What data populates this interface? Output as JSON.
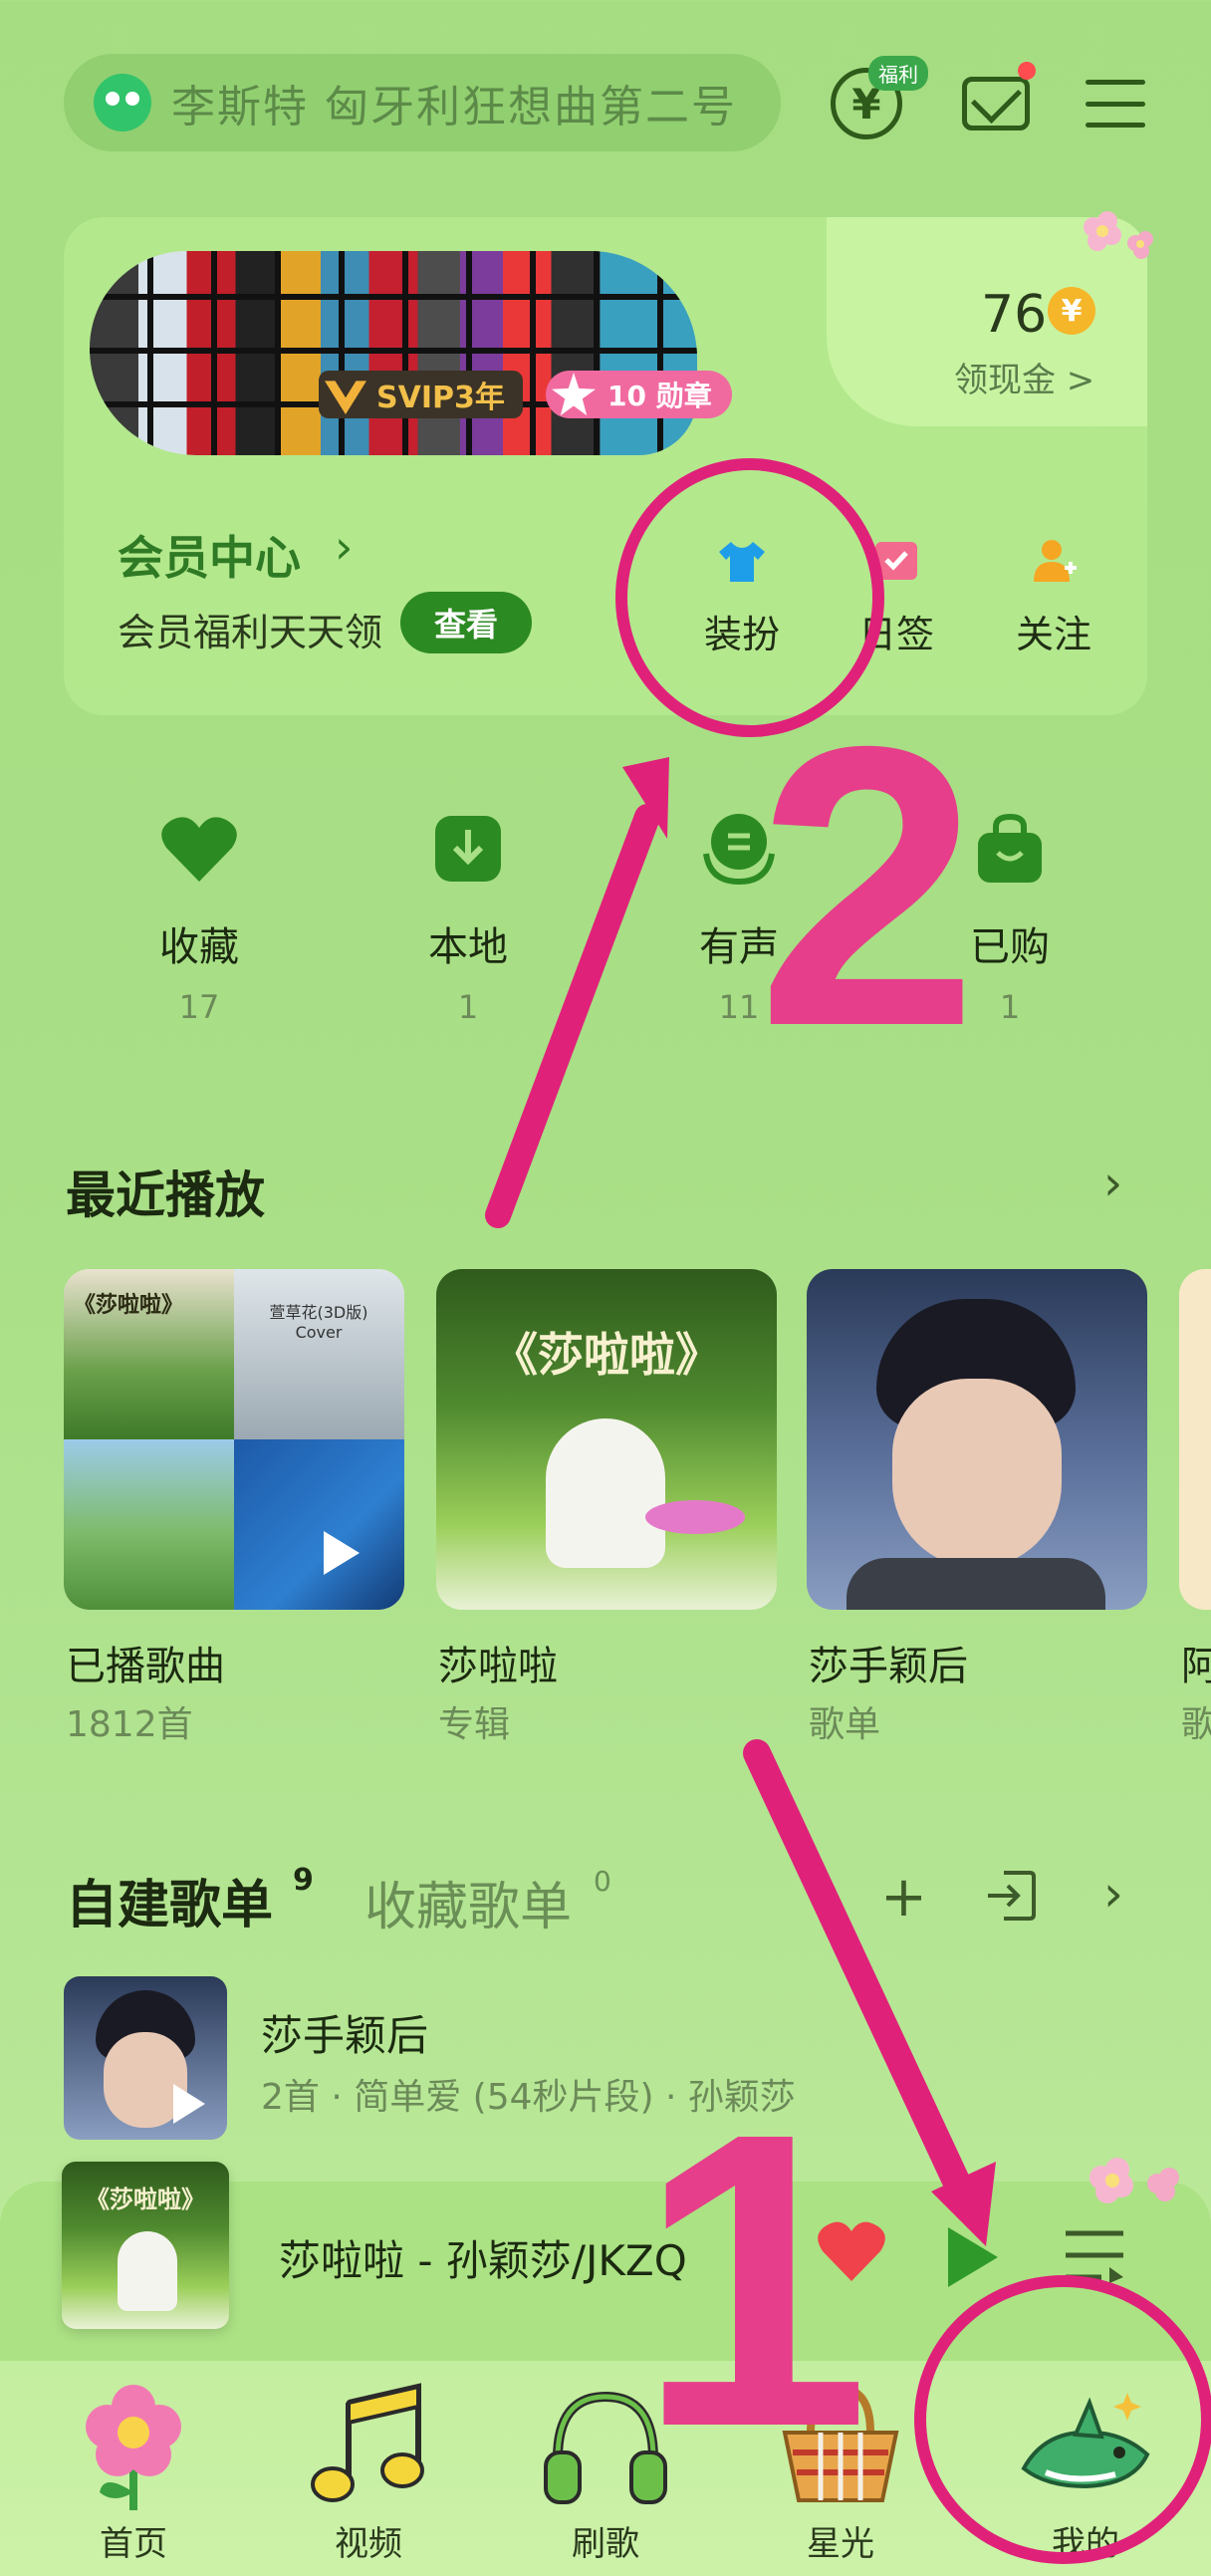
{
  "search": {
    "placeholder": "李斯特 匈牙利狂想曲第二号"
  },
  "header": {
    "welfare_badge": "福利",
    "yen_symbol": "¥"
  },
  "vip": {
    "svip_badge": "SVIP3年",
    "medal_badge": "10 勋章",
    "coins": "76",
    "coin_symbol": "¥",
    "coin_link": "领现金 >",
    "center_label": "会员中心",
    "benefit_text": "会员福利天天领",
    "view_button": "查看",
    "quick_actions": [
      {
        "label": "装扮",
        "icon": "shirt-icon"
      },
      {
        "label": "日签",
        "icon": "calendar-check-icon"
      },
      {
        "label": "关注",
        "icon": "user-add-icon"
      }
    ]
  },
  "categories": [
    {
      "label": "收藏",
      "count": "17",
      "icon": "heart-icon"
    },
    {
      "label": "本地",
      "count": "1",
      "icon": "download-icon"
    },
    {
      "label": "有声",
      "count": "11",
      "icon": "audiobook-icon"
    },
    {
      "label": "已购",
      "count": "1",
      "icon": "bag-icon"
    }
  ],
  "recent": {
    "title": "最近播放",
    "items": [
      {
        "title": "已播歌曲",
        "sub": "1812首",
        "cover_text": "《莎啦啦》",
        "cover_text2": "萱草花(3D版) Cover"
      },
      {
        "title": "莎啦啦",
        "sub": "专辑",
        "cover_text": "《莎啦啦》"
      },
      {
        "title": "莎手颖后",
        "sub": "歌单"
      },
      {
        "title": "阿",
        "sub": "歌"
      }
    ]
  },
  "playlists": {
    "tab_created": "自建歌单",
    "tab_created_count": "9",
    "tab_fav": "收藏歌单",
    "tab_fav_count": "0",
    "item": {
      "title": "莎手颖后",
      "sub": "2首 · 简单爱 (54秒片段) · 孙颖莎"
    }
  },
  "player": {
    "title": "莎啦啦 - 孙颖莎/JKZQ",
    "cover_text": "《莎啦啦》"
  },
  "tabbar": [
    {
      "label": "首页",
      "icon": "flower-icon"
    },
    {
      "label": "视频",
      "icon": "music-note-icon"
    },
    {
      "label": "刷歌",
      "icon": "headphones-icon"
    },
    {
      "label": "星光",
      "icon": "basket-icon"
    },
    {
      "label": "我的",
      "icon": "shark-icon"
    }
  ],
  "annotations": {
    "step1": "1",
    "step2": "2"
  },
  "colors": {
    "accent": "#2c8a22",
    "annotation": "#e0217a",
    "background": "#a9df86"
  }
}
